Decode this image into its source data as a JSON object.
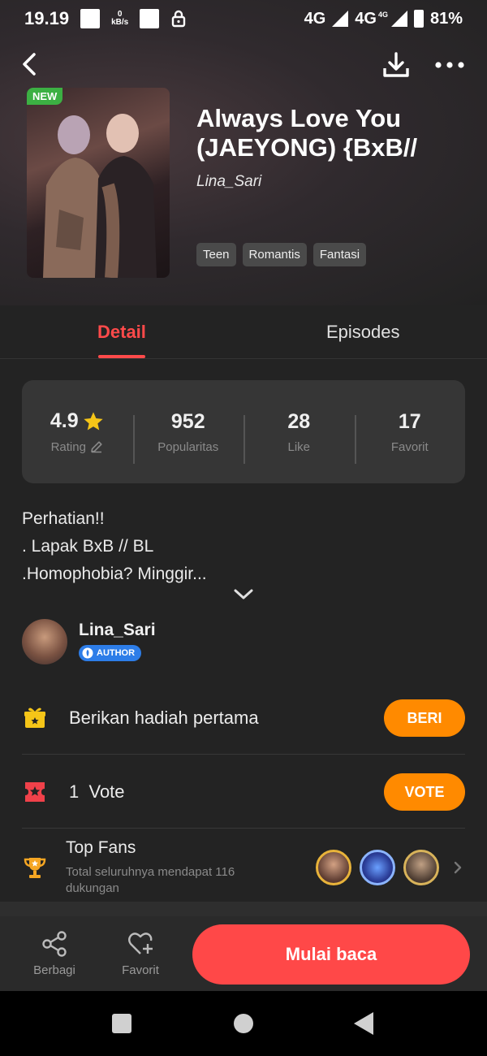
{
  "status_bar": {
    "time": "19.19",
    "net_speed_value": "0",
    "net_speed_unit": "kB/s",
    "net_label_1": "4G",
    "net_label_2": "4G",
    "net_label_2_sup": "4G",
    "battery": "81%"
  },
  "book": {
    "badge": "NEW",
    "title": "Always Love You (JAEYONG) {BxB//",
    "author": "Lina_Sari",
    "tags": [
      "Teen",
      "Romantis",
      "Fantasi"
    ]
  },
  "tabs": [
    {
      "label": "Detail",
      "active": true
    },
    {
      "label": "Episodes",
      "active": false
    }
  ],
  "stats": {
    "rating_value": "4.9",
    "rating_label": "Rating",
    "popularity_value": "952",
    "popularity_label": "Popularitas",
    "like_value": "28",
    "like_label": "Like",
    "favorite_value": "17",
    "favorite_label": "Favorit"
  },
  "description": {
    "line1": "Perhatian!!",
    "line2": ". Lapak BxB // BL",
    "line3": ".Homophobia? Minggir..."
  },
  "author_card": {
    "name": "Lina_Sari",
    "badge": "AUTHOR"
  },
  "gift": {
    "text": "Berikan hadiah pertama",
    "button": "BERI"
  },
  "vote": {
    "count": "1",
    "label": "Vote",
    "button": "VOTE"
  },
  "top_fans": {
    "title": "Top Fans",
    "subtitle": "Total seluruhnya mendapat 116 dukungan"
  },
  "bottom_bar": {
    "share_label": "Berbagi",
    "favorite_label": "Favorit",
    "read_button": "Mulai baca"
  },
  "colors": {
    "accent_red": "#ff4a4a",
    "accent_orange": "#ff8a00",
    "badge_green": "#3cb043",
    "author_badge_blue": "#2d7de8",
    "star_yellow": "#f5c518"
  }
}
